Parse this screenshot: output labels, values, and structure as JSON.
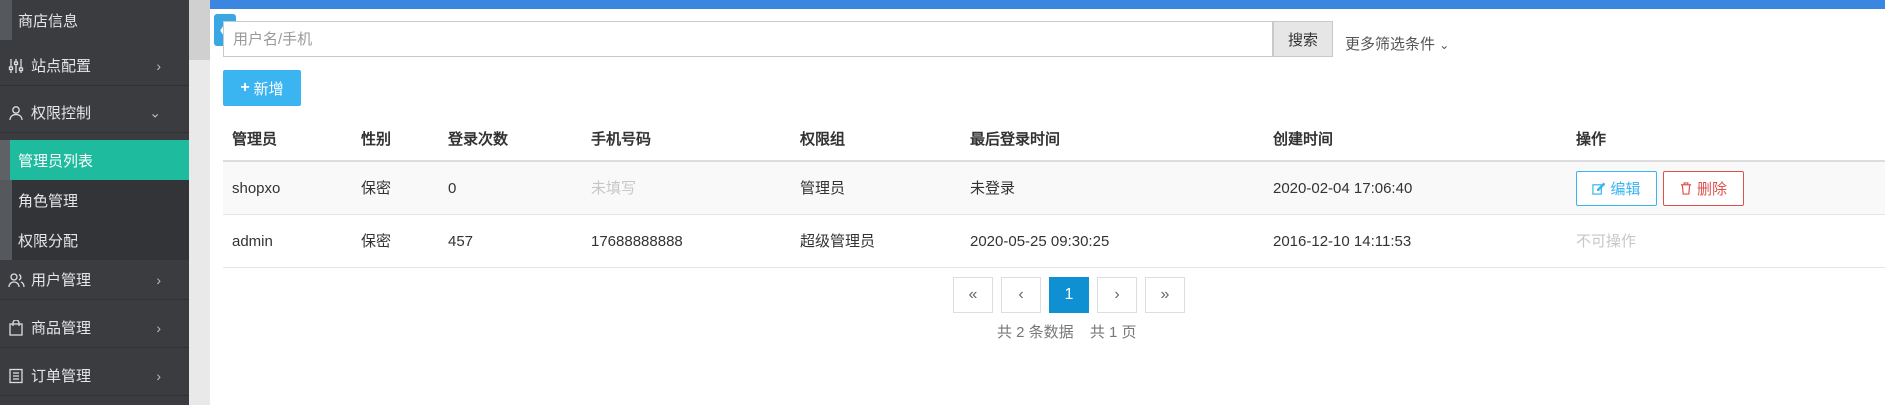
{
  "sidebar": {
    "shop_info": "商店信息",
    "site_config": "站点配置",
    "permission_control": "权限控制",
    "submenu": [
      "管理员列表",
      "角色管理",
      "权限分配"
    ],
    "user_mgmt": "用户管理",
    "goods_mgmt": "商品管理",
    "order_mgmt": "订单管理"
  },
  "colors": {
    "sidebar_bg": "#3a3c40",
    "active_item": "#1fbb9e",
    "topbar": "#3a86e0",
    "primary": "#3bb4f2",
    "danger": "#dd514c",
    "pager_active": "#0e90d2"
  },
  "search": {
    "placeholder": "用户名/手机",
    "button": "搜索",
    "more_filters": "更多筛选条件"
  },
  "toolbar": {
    "add_label": "新增"
  },
  "table": {
    "headers": [
      "管理员",
      "性别",
      "登录次数",
      "手机号码",
      "权限组",
      "最后登录时间",
      "创建时间",
      "操作"
    ],
    "rows": [
      {
        "admin": "shopxo",
        "gender": "保密",
        "login_count": "0",
        "phone": "未填写",
        "group": "管理员",
        "last_login": "未登录",
        "created": "2020-02-04 17:06:40",
        "edit": "编辑",
        "delete": "删除"
      },
      {
        "admin": "admin",
        "gender": "保密",
        "login_count": "457",
        "phone": "17688888888",
        "group": "超级管理员",
        "last_login": "2020-05-25 09:30:25",
        "created": "2016-12-10 14:11:53",
        "no_action": "不可操作"
      }
    ]
  },
  "pagination": {
    "first": "«",
    "prev": "‹",
    "current": "1",
    "next": "›",
    "last": "»",
    "total_records": "共 2 条数据",
    "total_pages": "共 1 页"
  },
  "icons": {
    "collapse": "double-chevron-left-icon",
    "site_config": "sliders-icon",
    "permission": "user-outline-icon",
    "users": "users-icon",
    "goods": "bag-icon",
    "orders": "list-icon"
  }
}
